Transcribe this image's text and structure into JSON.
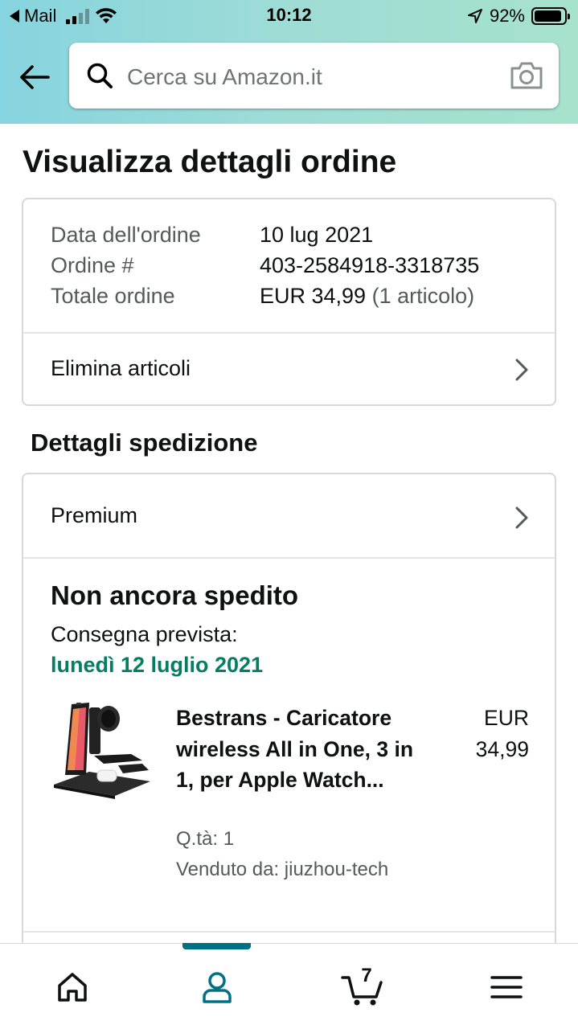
{
  "status_bar": {
    "back_app": "Mail",
    "time": "10:12",
    "battery": "92%"
  },
  "search": {
    "placeholder": "Cerca su Amazon.it"
  },
  "page": {
    "title": "Visualizza dettagli ordine"
  },
  "order": {
    "date_label": "Data dell'ordine",
    "date_value": "10 lug 2021",
    "number_label": "Ordine #",
    "number_value": "403-2584918-3318735",
    "total_label": "Totale ordine",
    "total_value": "EUR 34,99",
    "total_items": "(1 articolo)",
    "delete_items": "Elimina articoli"
  },
  "shipping": {
    "section_title": "Dettagli spedizione",
    "method": "Premium",
    "status": "Non ancora spedito",
    "delivery_label": "Consegna prevista:",
    "delivery_date": "lunedì 12 luglio 2021",
    "delivery_date_color": "#067d62",
    "product": {
      "title": "Bestrans - Caricatore wireless All in One, 3 in 1, per Apple Watch...",
      "price_currency": "EUR",
      "price_amount": "34,99",
      "quantity": "Q.tà: 1",
      "seller": "Venduto da: jiuzhou-tech"
    }
  },
  "bottom_nav": {
    "items": [
      "home-icon",
      "account-icon",
      "cart-icon",
      "menu-icon"
    ],
    "active": "account-icon",
    "cart_count": "7",
    "accent_color": "#007185"
  }
}
